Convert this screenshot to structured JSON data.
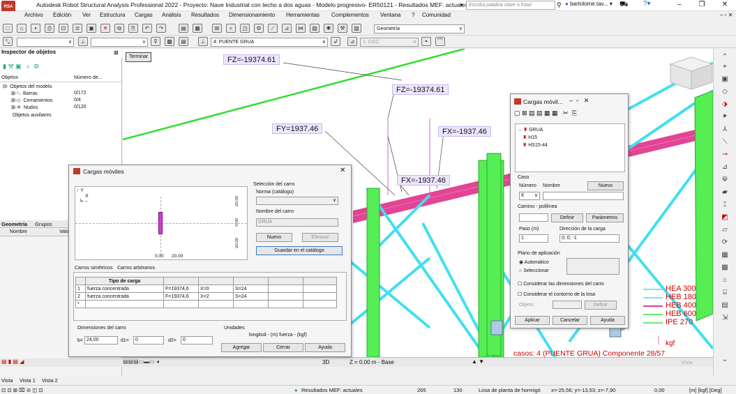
{
  "window": {
    "app_badge": "RSA",
    "title": "Autodesk Robot Structural Analysis Professional 2022 - Proyecto: Nave Industrial con techo a dos aguas - Modelo progresivo- ER50121 - Resultados MEF: actuales",
    "search_placeholder": "Escriba palabra clave o frase",
    "user": "bartolome.tav...",
    "min": "–",
    "max": "❐",
    "close": "✕"
  },
  "menu": [
    "Archivo",
    "Edición",
    "Ver",
    "Estructura",
    "Cargas",
    "Análisis",
    "Resultados",
    "Dimensionamiento",
    "Herramientas",
    "Complementos",
    "Ventana",
    "?",
    "Comunidad"
  ],
  "toolbar": {
    "geometry_combo": "Geometría",
    "case_combo": "4: PUENTE GRUA",
    "coord_combo": "1: CGC"
  },
  "inspector": {
    "title": "Inspector de objetos",
    "col_objects": "Objetos",
    "col_number": "Número de...",
    "model_objects": "Objetos del modelo",
    "rows": [
      {
        "label": "Barras",
        "value": "0/172"
      },
      {
        "label": "Cerramientos",
        "value": "0/4"
      },
      {
        "label": "Nudos",
        "value": "0/120"
      }
    ],
    "aux": "Objetos auxiliares"
  },
  "panel_tabs": {
    "geometry": "Geometría",
    "groups": "Grupos",
    "col_name": "Nombre",
    "col_value": "Valo"
  },
  "viewport": {
    "terminar": "Terminar",
    "labels": [
      {
        "text": "FZ=-19374.61"
      },
      {
        "text": "FZ=-19374.61"
      },
      {
        "text": "FY=1937.46"
      },
      {
        "text": "FX=-1937.46"
      },
      {
        "text": "FX=-1937.46"
      }
    ],
    "legend": [
      {
        "name": "HEA 300",
        "color": "#40e0f0"
      },
      {
        "name": "HEB 180",
        "color": "#40e0f0"
      },
      {
        "name": "HEB 400",
        "color": "#d0006f"
      },
      {
        "name": "HEB 600",
        "color": "#40e040"
      },
      {
        "name": "IPE 270",
        "color": "#40e040"
      }
    ],
    "units": "kgf",
    "case_caption": "casos: 4 (PUENTE GRUA) Componente 28/57",
    "view_mode": "3D",
    "z_level": "Z = 0,00 m - Base",
    "vista": "Vista"
  },
  "dlg_main": {
    "title": "Cargas móviles",
    "axis_y": "Y",
    "axis_x": "X",
    "dim_a": "20.00",
    "dim_b": "0.00",
    "dim_c": "20.00",
    "dim_top": "0.00",
    "dim_bottom": "20.00",
    "selection_title": "Selección del carro",
    "norma_label": "Norma (catálogo)",
    "vehicle_name_label": "Nombre del carro",
    "vehicle_name_value": "GRUA",
    "btn_new": "Nuevo",
    "btn_delete": "Eliminar",
    "btn_save": "Guardar en el catálogo",
    "tab_sym": "Carros simétricos",
    "tab_arb": "Carros arbitrarios",
    "tbl_header": "Tipo de carga",
    "rows": [
      {
        "n": "1",
        "type": "fuerza concentrada",
        "f": "F=19374,6",
        "x": "X=0",
        "s": "S=24"
      },
      {
        "n": "2",
        "type": "fuerza concentrada",
        "f": "F=19374,6",
        "x": "X=2",
        "s": "S=24"
      },
      {
        "n": "*",
        "type": "",
        "f": "",
        "x": "",
        "s": ""
      }
    ],
    "dims_title": "Dimensiones del carro",
    "b_label": "b=",
    "b_value": "24,00",
    "d1_label": "d1=",
    "d1_value": "0",
    "d2_label": "d2=",
    "d2_value": "0",
    "units_title": "Unidades",
    "units_value": "longitud - (m)   fuerza - (kgf)",
    "btn_add": "Agregar",
    "btn_close": "Cerrar",
    "btn_help": "Ayuda"
  },
  "dlg_small": {
    "title": "Cargas móvil...",
    "tree": [
      "GRUA",
      "H15",
      "HS15-44"
    ],
    "case_title": "Caso",
    "num_label": "Número",
    "name_label": "Nombre",
    "num_value": "8",
    "btn_new": "Nuevo",
    "route_title": "Camino - polilínea",
    "btn_define": "Definir",
    "btn_params": "Parámetros",
    "step_label": "Paso (m)",
    "step_value": "1",
    "dir_label": "Dirección de la carga",
    "dir_value": "0; 0; -1",
    "plane_title": "Plano de aplicación",
    "radio_auto": "Automático",
    "radio_select": "Seleccionar",
    "chk_dims": "Considerar las dimensiones del carro",
    "chk_contour": "Considerar el contorno de la losa",
    "object_label": "Objeto:",
    "btn_define2": "Definir",
    "btn_apply": "Aplicar",
    "btn_cancel": "Cancelar",
    "btn_help": "Ayuda"
  },
  "views_tabs": [
    "Vista",
    "Vista 1",
    "Vista 2"
  ],
  "status": {
    "results": "Resultados MEF: actuales",
    "n1": "265",
    "n2": "130",
    "surface": "Losa de planta de hormigó",
    "coords": "x=-25,56; y=-13,53; z=-7,90",
    "angle": "0,00",
    "units": "[m] [kgf] [Deg]"
  }
}
